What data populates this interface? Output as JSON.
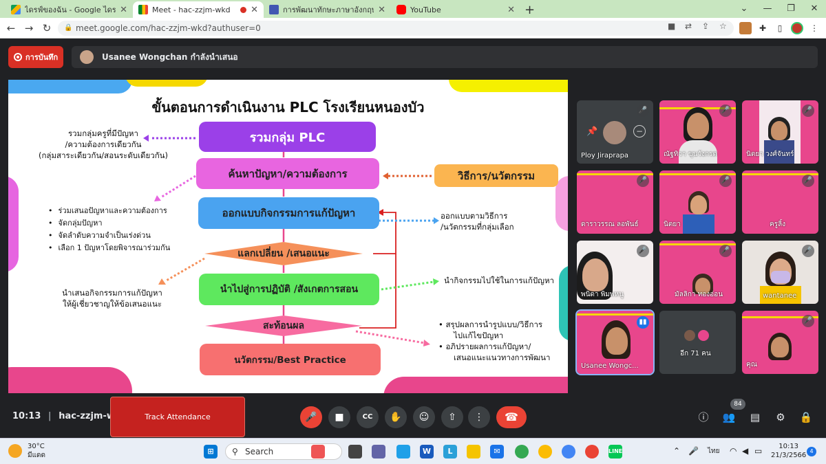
{
  "browser": {
    "tabs": [
      {
        "label": "ไดรฟ์ของฉัน - Google ไดรฟ์",
        "icon": "google-drive-icon"
      },
      {
        "label": "Meet - hac-zzjm-wkd",
        "icon": "google-meet-icon",
        "recording_indicator": true
      },
      {
        "label": "การพัฒนาทักษะภาษาอังกฤษ English",
        "icon": "google-forms-icon"
      },
      {
        "label": "YouTube",
        "icon": "youtube-icon"
      }
    ],
    "url": "meet.google.com/hac-zzjm-wkd?authuser=0"
  },
  "meet": {
    "record_label": "การบันทึก",
    "presenter_text": "Usanee Wongchan กำลังนำเสนอ",
    "meeting_time": "10:13",
    "meeting_code": "hac-zzjm-wkd",
    "track_attendance_label": "Track Attendance",
    "people_count": "84",
    "more_label": "อีก 71 คน"
  },
  "slide": {
    "title": "ขั้นตอนการดำเนินงาน PLC โรงเรียนหนองบัว",
    "steps": [
      "รวมกลุ่ม PLC",
      "ค้นหาปัญหา/ความต้องการ",
      "ออกแบบกิจกรรมการแก้ปัญหา",
      "แลกเปลี่ยน /เสนอแนะ",
      "นำไปสู่การปฏิบัติ /สังเกตการสอน",
      "สะท้อนผล",
      "นวัตกรรม/Best Practice"
    ],
    "side_box": "วิธีการ/นวัตกรรม",
    "left_note_1": [
      "รวมกลุ่มครูที่มีปัญหา",
      "/ความต้องการเดียวกัน",
      "(กลุ่มสาระเดียวกัน/สอนระดับเดียวกัน)"
    ],
    "left_bullets": [
      "ร่วมเสนอปัญหาและความต้องการ",
      "จัดกลุ่มปัญหา",
      "จัดลำดับความจำเป็นเร่งด่วน",
      "เลือก 1 ปัญหาโดยพิจารณาร่วมกัน"
    ],
    "left_note_2": [
      "นำเสนอกิจกรรมการแก้ปัญหา",
      "ให้ผู้เชี่ยวชาญให้ข้อเสนอแนะ"
    ],
    "right_note_1": [
      "ออกแบบตามวิธีการ",
      "/นวัตกรรมที่กลุ่มเลือก"
    ],
    "right_note_2": "นำกิจกรรมไปใช้ในการแก้ปัญหา",
    "right_bullets": [
      [
        "สรุปผลการนำรูปแบบ/วิธีการ",
        "ไปแก้ไขปัญหา"
      ],
      [
        "อภิปรายผลการแก้ปัญหา/",
        "เสนอแนะแนวทางการพัฒนา"
      ]
    ]
  },
  "participants": [
    {
      "name": "Ploy Jiraprapa"
    },
    {
      "name": "ณัฐทิวา ขุนวังกรด"
    },
    {
      "name": "นิตยา วงศ์จันทร์"
    },
    {
      "name": "ดาราวรรณ ลอพันธ์"
    },
    {
      "name": "นิตยา"
    },
    {
      "name": "ครูลิ้ง"
    },
    {
      "name": "พนิดา พิมพหนู"
    },
    {
      "name": "มัลลิกา ทองอ่อน"
    },
    {
      "name": "wantanee"
    },
    {
      "name": "Usanee Wongc..."
    },
    {
      "name": "อีก 71 คน"
    },
    {
      "name": "คุณ"
    }
  ],
  "taskbar": {
    "temperature": "30°C",
    "weather_text": "มีแดด",
    "search_label": "Search",
    "language": "ไทย",
    "time": "10:13",
    "date": "21/3/2566",
    "notification_count": "4"
  },
  "colors": {
    "record_red": "#d93025",
    "meet_bg": "#202124",
    "slide_purple": "#9b40e8",
    "slide_magenta": "#e865e0",
    "slide_blue": "#4aa3f0",
    "slide_orange": "#f5905a",
    "slide_green": "#5ee85e",
    "slide_pink": "#f76ba0",
    "slide_coral": "#f77070",
    "side_box_orange": "#fbb550"
  }
}
